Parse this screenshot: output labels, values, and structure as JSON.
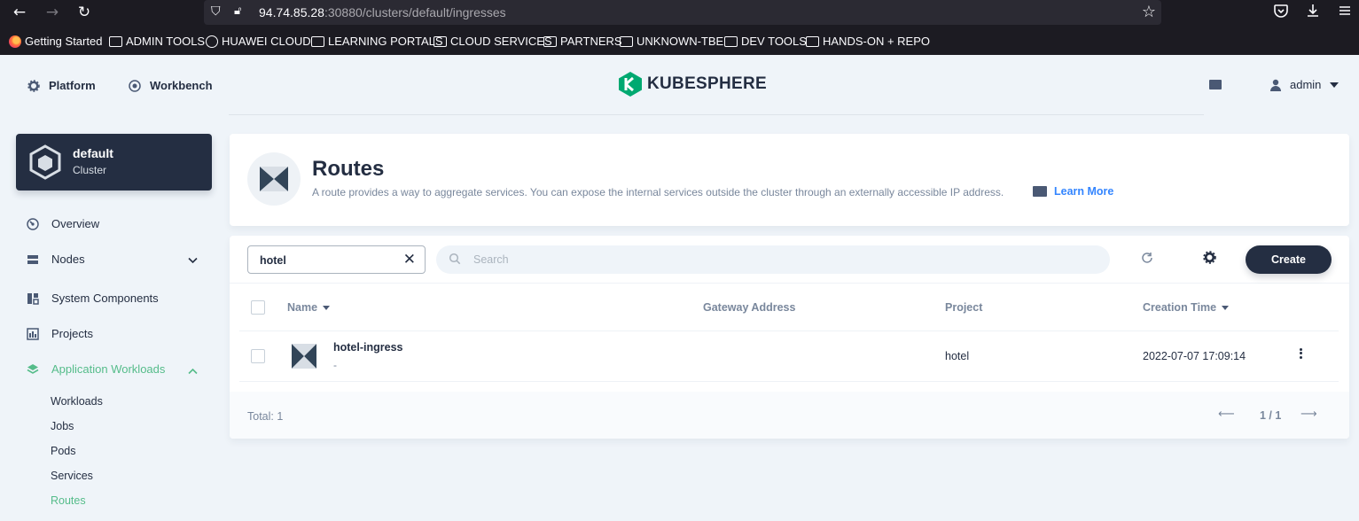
{
  "browser": {
    "url_host": "94.74.85.28",
    "url_rest": ":30880/clusters/default/ingresses",
    "bookmarks": [
      "Getting Started",
      "ADMIN TOOLS",
      "HUAWEI CLOUD",
      "LEARNING PORTALS",
      "CLOUD SERVICES",
      "PARTNERS",
      "UNKNOWN-TBE",
      "DEV TOOLS",
      "HANDS-ON + REPO"
    ]
  },
  "header": {
    "platform_label": "Platform",
    "workbench_label": "Workbench",
    "logo_text": "KUBESPHERE",
    "user_name": "admin",
    "brand_color": "#00a971"
  },
  "sidebar": {
    "cluster_name": "default",
    "cluster_kind": "Cluster",
    "items": [
      {
        "label": "Overview",
        "icon": "dashboard-icon"
      },
      {
        "label": "Nodes",
        "icon": "nodes-icon"
      },
      {
        "label": "System Components",
        "icon": "components-icon"
      },
      {
        "label": "Projects",
        "icon": "projects-icon"
      },
      {
        "label": "Application Workloads",
        "icon": "appcenter-icon"
      }
    ],
    "sub_items": [
      "Workloads",
      "Jobs",
      "Pods",
      "Services",
      "Routes"
    ],
    "active_color": "#55bc8a"
  },
  "banner": {
    "title": "Routes",
    "description": "A route provides a way to aggregate services. You can expose the internal services outside the cluster through an externally accessible IP address.",
    "learn_more": "Learn More"
  },
  "toolbar": {
    "filter_value": "hotel",
    "search_placeholder": "Search",
    "create_label": "Create"
  },
  "table": {
    "columns": [
      "Name",
      "Gateway Address",
      "Project",
      "Creation Time"
    ],
    "rows": [
      {
        "name": "hotel-ingress",
        "sub": "-",
        "gateway": "",
        "project": "hotel",
        "created": "2022-07-07 17:09:14"
      }
    ],
    "total": "Total: 1",
    "page": "1 / 1"
  }
}
